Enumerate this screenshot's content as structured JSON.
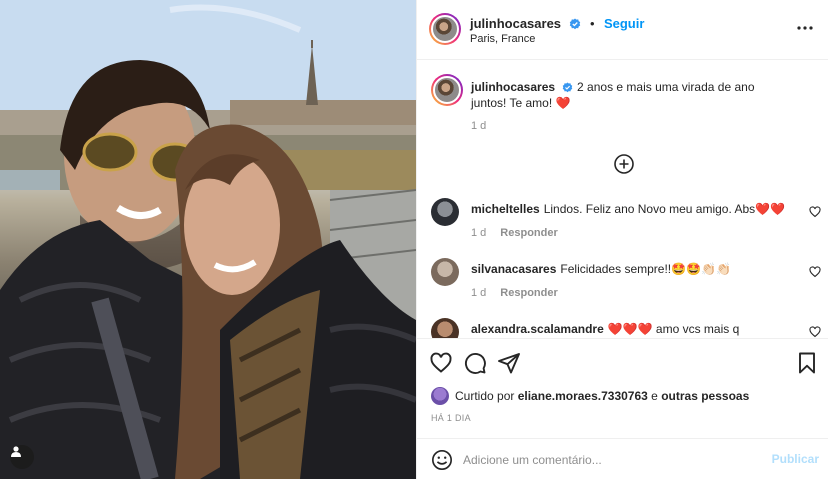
{
  "post": {
    "author": "julinhocasares",
    "location": "Paris, France",
    "follow_label": "Seguir",
    "separator": "•",
    "caption": "2 anos e mais uma virada de ano juntos! Te amo! ❤️",
    "caption_time": "1 d"
  },
  "comments": [
    {
      "user": "micheltelles",
      "text": "Lindos. Feliz ano Novo meu amigo. Abs❤️❤️",
      "time": "1 d",
      "reply_label": "Responder"
    },
    {
      "user": "silvanacasares",
      "text": "Felicidades sempre!!🤩🤩👏🏻👏🏻",
      "time": "1 d",
      "reply_label": "Responder"
    },
    {
      "user": "alexandra.scalamandre",
      "text": "❤️❤️❤️ amo vcs mais q",
      "time": "",
      "reply_label": ""
    }
  ],
  "likes": {
    "prefix": "Curtido por",
    "user": "eliane.moraes.7330763",
    "connector": "e",
    "others": "outras pessoas"
  },
  "timestamp": "HÁ 1 DIA",
  "comment_box": {
    "placeholder": "Adicione um comentário...",
    "post_label": "Publicar"
  },
  "colors": {
    "accent": "#0095f6",
    "verified": "#3897f0",
    "heart": "#ed1c24",
    "post_disabled": "#b2dffc"
  },
  "icons": {
    "verified": "verified-badge-icon",
    "more": "more-options-icon",
    "load_more": "plus-circle-icon",
    "like": "heart-icon",
    "comment": "comment-icon",
    "share": "send-icon",
    "save": "bookmark-icon",
    "emoji": "smiley-icon",
    "tagged_user": "user-tag-icon"
  }
}
